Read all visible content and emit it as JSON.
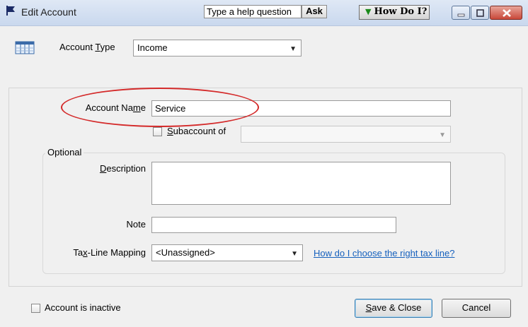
{
  "window": {
    "title": "Edit Account",
    "help_placeholder": "Type a help question",
    "ask_label": "Ask",
    "how_do_i_label": "How Do I?"
  },
  "account_type": {
    "label_pre": "Account ",
    "label_ul": "T",
    "label_post": "ype",
    "value": "Income"
  },
  "account_name": {
    "label_pre": "Account Na",
    "label_ul": "m",
    "label_post": "e",
    "value": "Service"
  },
  "subaccount": {
    "label_ul": "S",
    "label_post": "ubaccount of",
    "checked": false,
    "value": ""
  },
  "optional": {
    "section_label": "Optional",
    "description_label_ul": "D",
    "description_label_post": "escription",
    "description_value": "",
    "note_label": "Note",
    "note_value": "",
    "tax_label_pre": "Ta",
    "tax_label_ul": "x",
    "tax_label_post": "-Line Mapping",
    "tax_value": "<Unassigned>",
    "tax_link": "How do I choose the right tax line?"
  },
  "footer": {
    "inactive_label": "Account is inactive",
    "inactive_checked": false,
    "save_label_ul": "S",
    "save_label_post": "ave & Close",
    "cancel_label": "Cancel"
  },
  "colors": {
    "annotation": "#d42a2a",
    "link": "#1560bd"
  }
}
